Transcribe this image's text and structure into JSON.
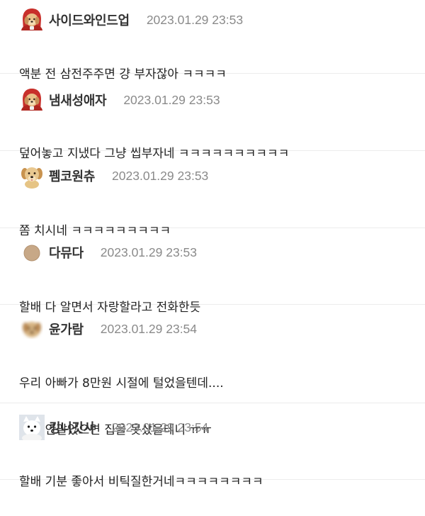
{
  "comments": [
    {
      "nickname": "사이드와인드업",
      "date": "2023.01.29 23:53",
      "lines": [
        "액분 전 삼전주주면 걍 부자잖아 ㅋㅋㅋㅋ"
      ],
      "avatar": "puppy-red-hood-icon"
    },
    {
      "nickname": "냄새성애자",
      "date": "2023.01.29 23:53",
      "lines": [
        "덮어놓고 지냈다 그냥 씹부자네 ㅋㅋㅋㅋㅋㅋㅋㅋㅋㅋ"
      ],
      "avatar": "puppy-red-hood-icon"
    },
    {
      "nickname": "펨코원츄",
      "date": "2023.01.29 23:53",
      "lines": [
        "쫌 치시네 ㅋㅋㅋㅋㅋㅋㅋㅋㅋ"
      ],
      "avatar": "golden-puppy-icon"
    },
    {
      "nickname": "다뮤다",
      "date": "2023.01.29 23:53",
      "lines": [
        "할배 다 알면서 자랑할라고 전화한듯"
      ],
      "avatar": "tan-circle-icon"
    },
    {
      "nickname": "윤가람",
      "date": "2023.01.29 23:54",
      "lines": [
        "우리 아빠가 8만원 시절에 털었을텐데....",
        "근데 안팔았으면 집을 못샀을테니 ㅠㅠ"
      ],
      "avatar": "blurred-puppy-icon"
    },
    {
      "nickname": "킹니갓사",
      "date": "2023.01.29 23:54",
      "lines": [
        "할배 기분 좋아서 비틱질한거네ㅋㅋㅋㅋㅋㅋㅋㅋ"
      ],
      "avatar": "white-dog-icon"
    }
  ],
  "colors": {
    "nickname": "#333333",
    "date": "#8a8a8a",
    "body": "#222222",
    "divider": "#ececec"
  }
}
